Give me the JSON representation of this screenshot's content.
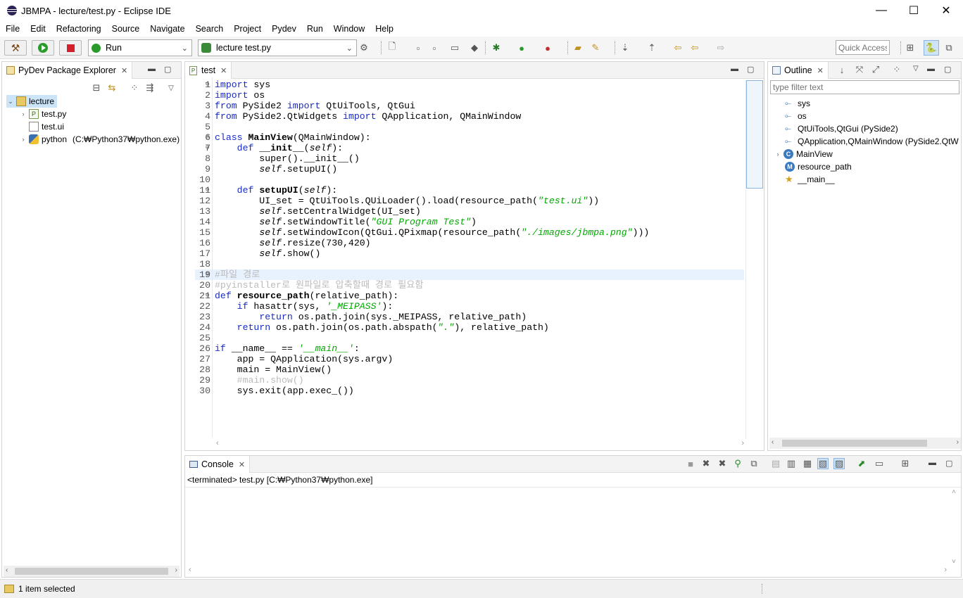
{
  "window": {
    "title": "JBMPA - lecture/test.py - Eclipse IDE",
    "minimize": "—",
    "maximize": "☐",
    "close": "✕"
  },
  "menu": [
    "File",
    "Edit",
    "Refactoring",
    "Source",
    "Navigate",
    "Search",
    "Project",
    "Pydev",
    "Run",
    "Window",
    "Help"
  ],
  "toolbar": {
    "run_config": "Run",
    "launch_target": "lecture test.py",
    "quick_access": "Quick Access"
  },
  "explorer": {
    "tab": "PyDev Package Explorer",
    "items": [
      {
        "label": "lecture",
        "extra": ""
      },
      {
        "label": "test.py",
        "extra": ""
      },
      {
        "label": "test.ui",
        "extra": ""
      },
      {
        "label": "python",
        "extra": "(C:₩Python37₩python.exe)"
      }
    ]
  },
  "editor": {
    "tab": "test",
    "current_line": 19
  },
  "outline": {
    "tab": "Outline",
    "filter_placeholder": "type filter text",
    "items": [
      {
        "label": "sys",
        "icon": "import-icon"
      },
      {
        "label": "os",
        "icon": "import-icon"
      },
      {
        "label": "QtUiTools,QtGui (PySide2)",
        "icon": "import-icon"
      },
      {
        "label": "QApplication,QMainWindow (PySide2.QtW",
        "icon": "import-icon"
      },
      {
        "label": "MainView",
        "icon": "class-icon"
      },
      {
        "label": "resource_path",
        "icon": "method-icon"
      },
      {
        "label": "__main__",
        "icon": "main-icon"
      }
    ]
  },
  "console": {
    "tab": "Console",
    "status": "<terminated> test.py [C:₩Python37₩python.exe]"
  },
  "statusbar": {
    "text": "1 item selected"
  },
  "colors": {
    "keyword": "#1a2bc0",
    "string": "#00aa00",
    "comment": "#bbbbbb",
    "current_line": "#e8f2fe"
  }
}
